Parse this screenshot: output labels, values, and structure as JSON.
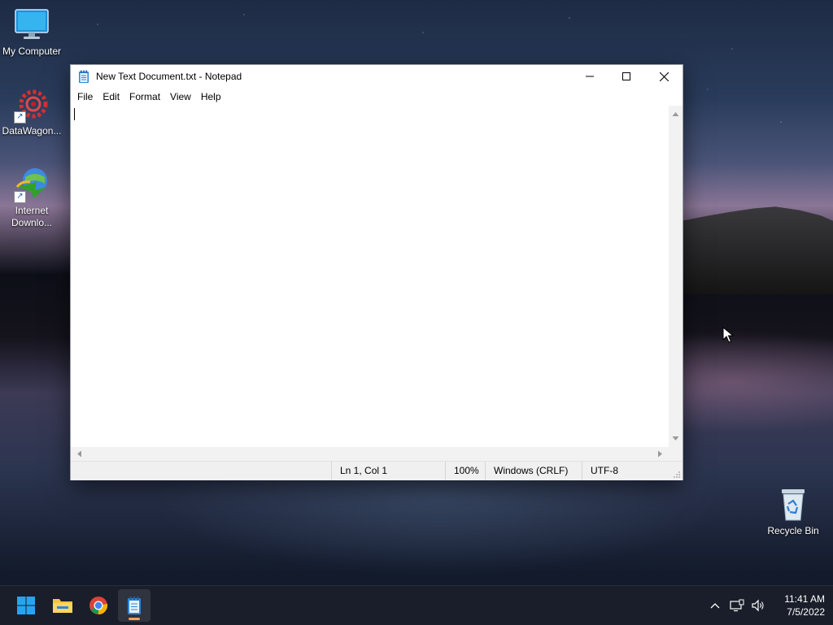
{
  "desktop": {
    "icons": [
      {
        "label": "My Computer"
      },
      {
        "label": "DataWagon..."
      },
      {
        "label": "Internet Downlo..."
      },
      {
        "label": "Recycle Bin"
      }
    ]
  },
  "window": {
    "title": "New Text Document.txt - Notepad",
    "menu": [
      "File",
      "Edit",
      "Format",
      "View",
      "Help"
    ],
    "content": "",
    "status": {
      "position": "Ln 1, Col 1",
      "zoom": "100%",
      "line_ending": "Windows (CRLF)",
      "encoding": "UTF-8"
    }
  },
  "taskbar": {
    "apps": [
      "start-icon",
      "file-explorer-icon",
      "chrome-icon",
      "notepad-icon"
    ],
    "clock": {
      "time": "11:41 AM",
      "date": "7/5/2022"
    }
  },
  "colors": {
    "accent": "#0078d4",
    "taskbar": "#1a1e2a",
    "window_bg": "#ffffff",
    "statusbar": "#f0f0f0"
  }
}
